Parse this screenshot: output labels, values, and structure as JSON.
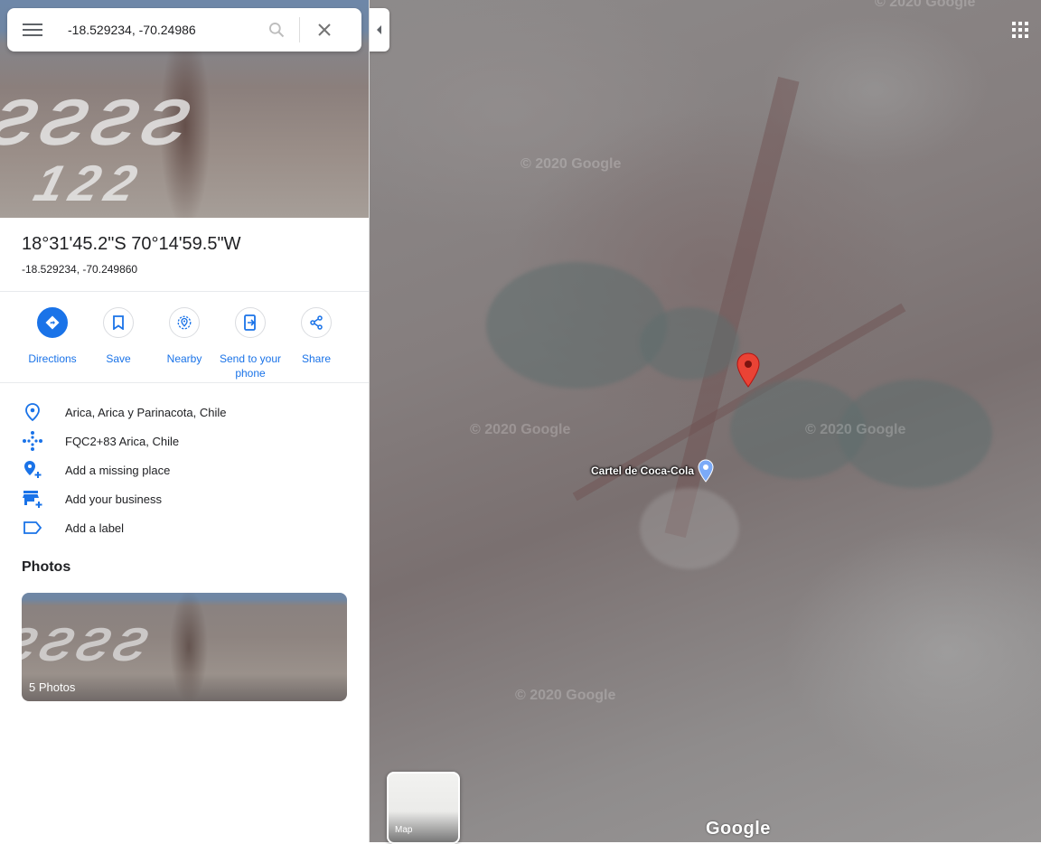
{
  "search": {
    "query": "-18.529234, -70.24986"
  },
  "place": {
    "dms": "18°31'45.2\"S 70°14'59.5\"W",
    "decimal": "-18.529234, -70.249860"
  },
  "actions": [
    {
      "label": "Directions"
    },
    {
      "label": "Save"
    },
    {
      "label": "Nearby"
    },
    {
      "label": "Send to your phone"
    },
    {
      "label": "Share"
    }
  ],
  "info": [
    {
      "icon": "location-pin-icon",
      "text": "Arica, Arica y Parinacota, Chile"
    },
    {
      "icon": "plus-code-icon",
      "text": "FQC2+83 Arica, Chile"
    },
    {
      "icon": "add-place-icon",
      "text": "Add a missing place"
    },
    {
      "icon": "add-business-icon",
      "text": "Add your business"
    },
    {
      "icon": "label-icon",
      "text": "Add a label"
    }
  ],
  "photos": {
    "heading": "Photos",
    "count_label": "5 Photos"
  },
  "map": {
    "poi_label": "Cartel de Coca-Cola",
    "watermark": "© 2020 Google",
    "layer_toggle_label": "Map",
    "logo": "Google"
  },
  "colors": {
    "accent": "#1a73e8",
    "pin_red": "#ea4335",
    "poi_blue": "#7baaf7"
  }
}
